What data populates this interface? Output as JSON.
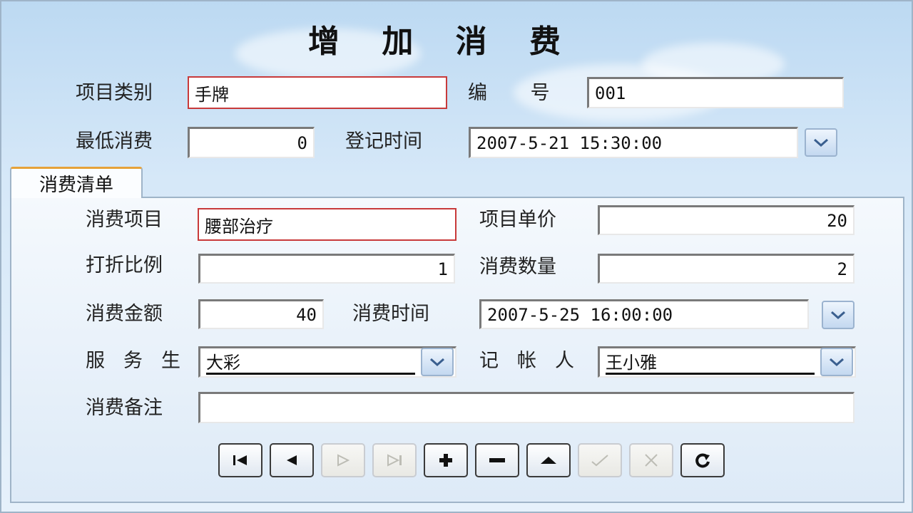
{
  "title": "增 加 消 费",
  "header": {
    "category_label": "项目类别",
    "category_value": "手牌",
    "number_label": "编 号",
    "number_value": "001",
    "min_spend_label": "最低消费",
    "min_spend_value": "0",
    "register_time_label": "登记时间",
    "register_time_value": "2007-5-21 15:30:00"
  },
  "tab": {
    "label": "消费清单"
  },
  "detail": {
    "item_label": "消费项目",
    "item_value": "腰部治疗",
    "unit_price_label": "项目单价",
    "unit_price_value": "20",
    "discount_label": "打折比例",
    "discount_value": "1",
    "quantity_label": "消费数量",
    "quantity_value": "2",
    "amount_label": "消费金额",
    "amount_value": "40",
    "time_label": "消费时间",
    "time_value": "2007-5-25 16:00:00",
    "waiter_label": "服务生",
    "waiter_value": "大彩",
    "bookkeeper_label": "记帐人",
    "bookkeeper_value": "王小雅",
    "remark_label": "消费备注",
    "remark_value": ""
  },
  "navigator": {
    "buttons": [
      {
        "icon": "first-record-icon",
        "enabled": true
      },
      {
        "icon": "prior-record-icon",
        "enabled": true
      },
      {
        "icon": "next-record-icon",
        "enabled": false
      },
      {
        "icon": "last-record-icon",
        "enabled": false
      },
      {
        "icon": "insert-icon",
        "enabled": true
      },
      {
        "icon": "delete-icon",
        "enabled": true
      },
      {
        "icon": "edit-icon",
        "enabled": true
      },
      {
        "icon": "post-icon",
        "enabled": false
      },
      {
        "icon": "cancel-icon",
        "enabled": false
      },
      {
        "icon": "refresh-icon",
        "enabled": true
      }
    ]
  },
  "colors": {
    "required_border": "#c83a3a",
    "tab_accent": "#e6a23a",
    "background": "#d6e8f8"
  }
}
